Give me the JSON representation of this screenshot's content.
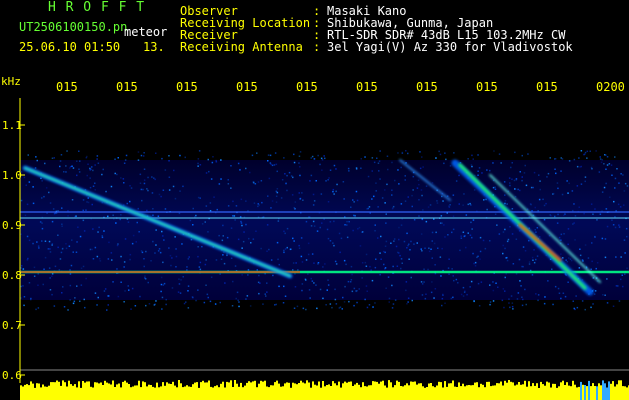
{
  "header": {
    "app_title": "H R O F F T",
    "filename": "UT2506100150.pn",
    "mode": "meteor",
    "datetime": "25.06.10 01:50",
    "count": "13.",
    "fields": [
      {
        "label": "Observer",
        "value": "Masaki Kano"
      },
      {
        "label": "Receiving Location",
        "value": "Shibukawa, Gunma, Japan"
      },
      {
        "label": "Receiver",
        "value": "RTL-SDR SDR# 43dB L15 103.2MHz CW"
      },
      {
        "label": "Receiving Antenna",
        "value": "3el Yagi(V) Az 330 for Vladivostok"
      }
    ]
  },
  "chart_data": {
    "type": "heatmap",
    "y_unit": "kHz",
    "y_ticks": [
      "1.1",
      "1.0",
      "0.9",
      "0.8",
      "0.7",
      "0.6"
    ],
    "x_ticks": [
      "015",
      "015",
      "015",
      "015",
      "015",
      "015",
      "015",
      "015",
      "015",
      "0200"
    ],
    "colors": {
      "background": "#000066",
      "trace": "#00ff66",
      "strong": "#ff2200",
      "power_bar": "#ffff00"
    }
  }
}
